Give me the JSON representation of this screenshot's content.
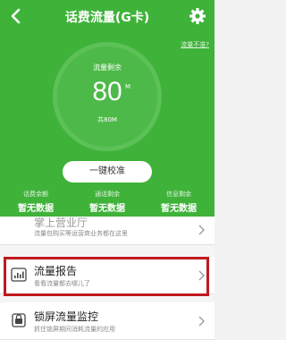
{
  "header": {
    "title": "话费流量(G卡)",
    "inaccurate_link": "流量不准?"
  },
  "usage": {
    "label": "流量剩余",
    "value": "80",
    "unit": "M",
    "total": "共80M",
    "remaining_fraction": 1.0
  },
  "calibrate_button": "一键校准",
  "stats": [
    {
      "label": "话费余额",
      "value": "暂无数据"
    },
    {
      "label": "通话剩余",
      "value": "暂无数据"
    },
    {
      "label": "信息剩余",
      "value": "暂无数据"
    }
  ],
  "list": [
    {
      "title": "掌上营业厅",
      "desc": "流量包购买等运营商业务都在这里",
      "icon": "store-icon"
    },
    {
      "title": "流量报告",
      "desc": "看看流量都去哪儿了",
      "icon": "report-chart-icon"
    },
    {
      "title": "锁屏流量监控",
      "desc": "抓住锁屏期间消耗流量的应用",
      "icon": "lock-monitor-icon"
    }
  ],
  "colors": {
    "header_green": "#3fb23a",
    "highlight_red": "#c0191f"
  }
}
